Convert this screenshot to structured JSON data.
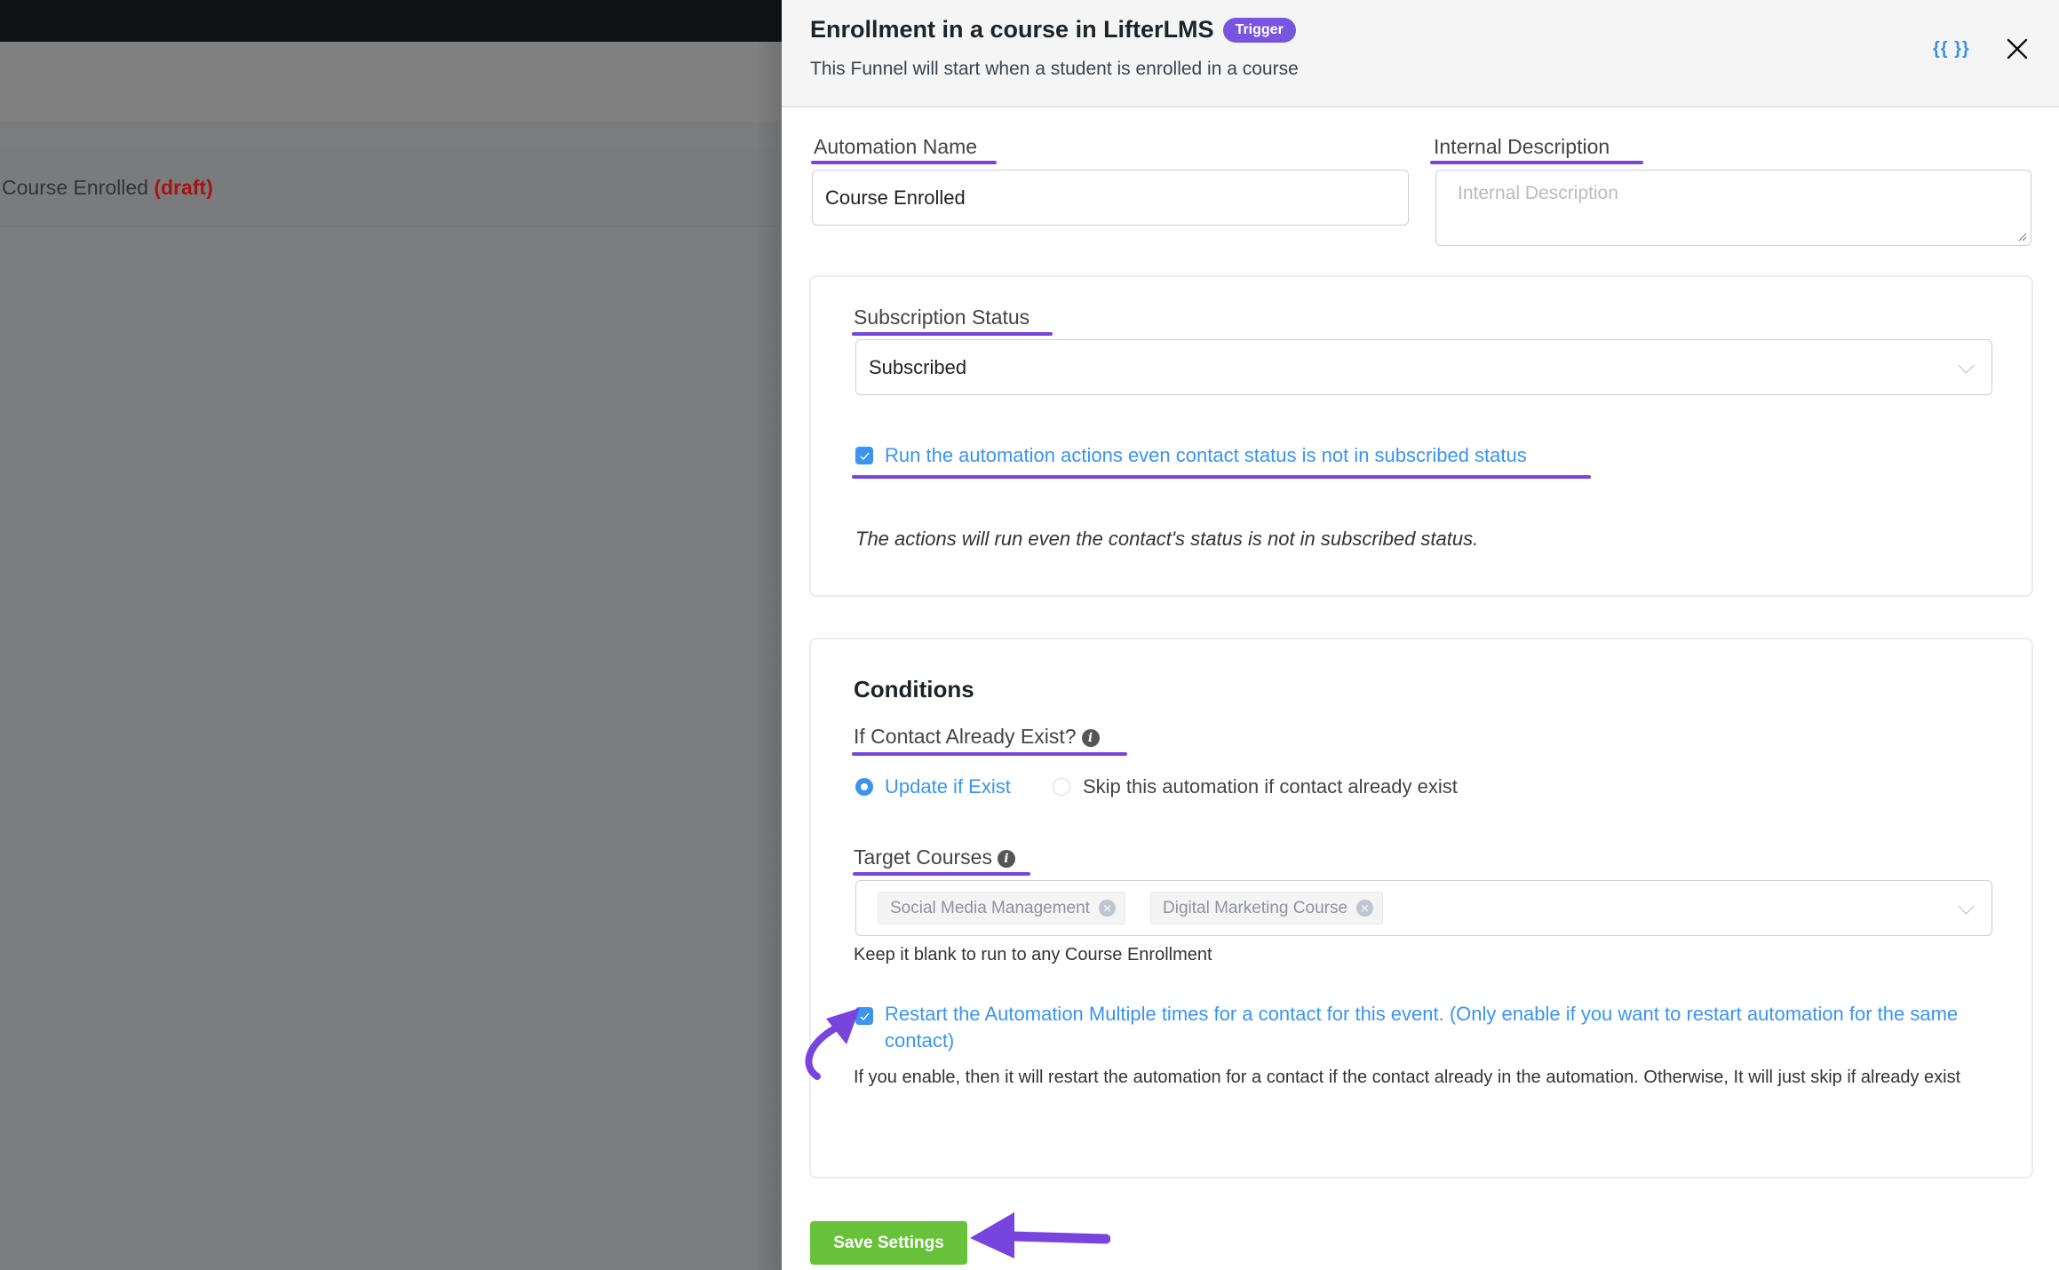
{
  "background": {
    "row_title": "Course Enrolled",
    "row_status": "(draft)"
  },
  "drawer": {
    "title": "Enrollment in a course in LifterLMS",
    "badge": "Trigger",
    "subtitle": "This Funnel will start when a student is enrolled in a course",
    "shortcode_icon": "{{ }}",
    "close_icon": "close-icon"
  },
  "form": {
    "automation_name": {
      "label": "Automation Name",
      "value": "Course Enrolled"
    },
    "internal_description": {
      "label": "Internal Description",
      "placeholder": "Internal Description",
      "value": ""
    },
    "subscription": {
      "label": "Subscription Status",
      "selected": "Subscribed",
      "run_even_unsubscribed": {
        "checked": true,
        "label": "Run the automation actions even contact status is not in subscribed status"
      },
      "note": "The actions will run even the contact's status is not in subscribed status."
    },
    "conditions": {
      "heading": "Conditions",
      "contact_exist": {
        "label": "If Contact Already Exist?",
        "options": [
          {
            "label": "Update if Exist",
            "selected": true
          },
          {
            "label": "Skip this automation if contact already exist",
            "selected": false
          }
        ]
      },
      "target_courses": {
        "label": "Target Courses",
        "tags": [
          "Social Media Management",
          "Digital Marketing Course"
        ],
        "help": "Keep it blank to run to any Course Enrollment"
      },
      "restart": {
        "checked": true,
        "label": "Restart the Automation Multiple times for a contact for this event. (Only enable if you want to restart automation for the same contact)",
        "help": "If you enable, then it will restart the automation for a contact if the contact already in the automation. Otherwise, It will just skip if already exist"
      }
    }
  },
  "actions": {
    "save_label": "Save Settings"
  },
  "colors": {
    "accent_blue": "#3b94f0",
    "annotation_purple": "#7744dd",
    "badge_purple": "#7755e0",
    "save_green": "#67c23a",
    "draft_red": "#a51414"
  }
}
